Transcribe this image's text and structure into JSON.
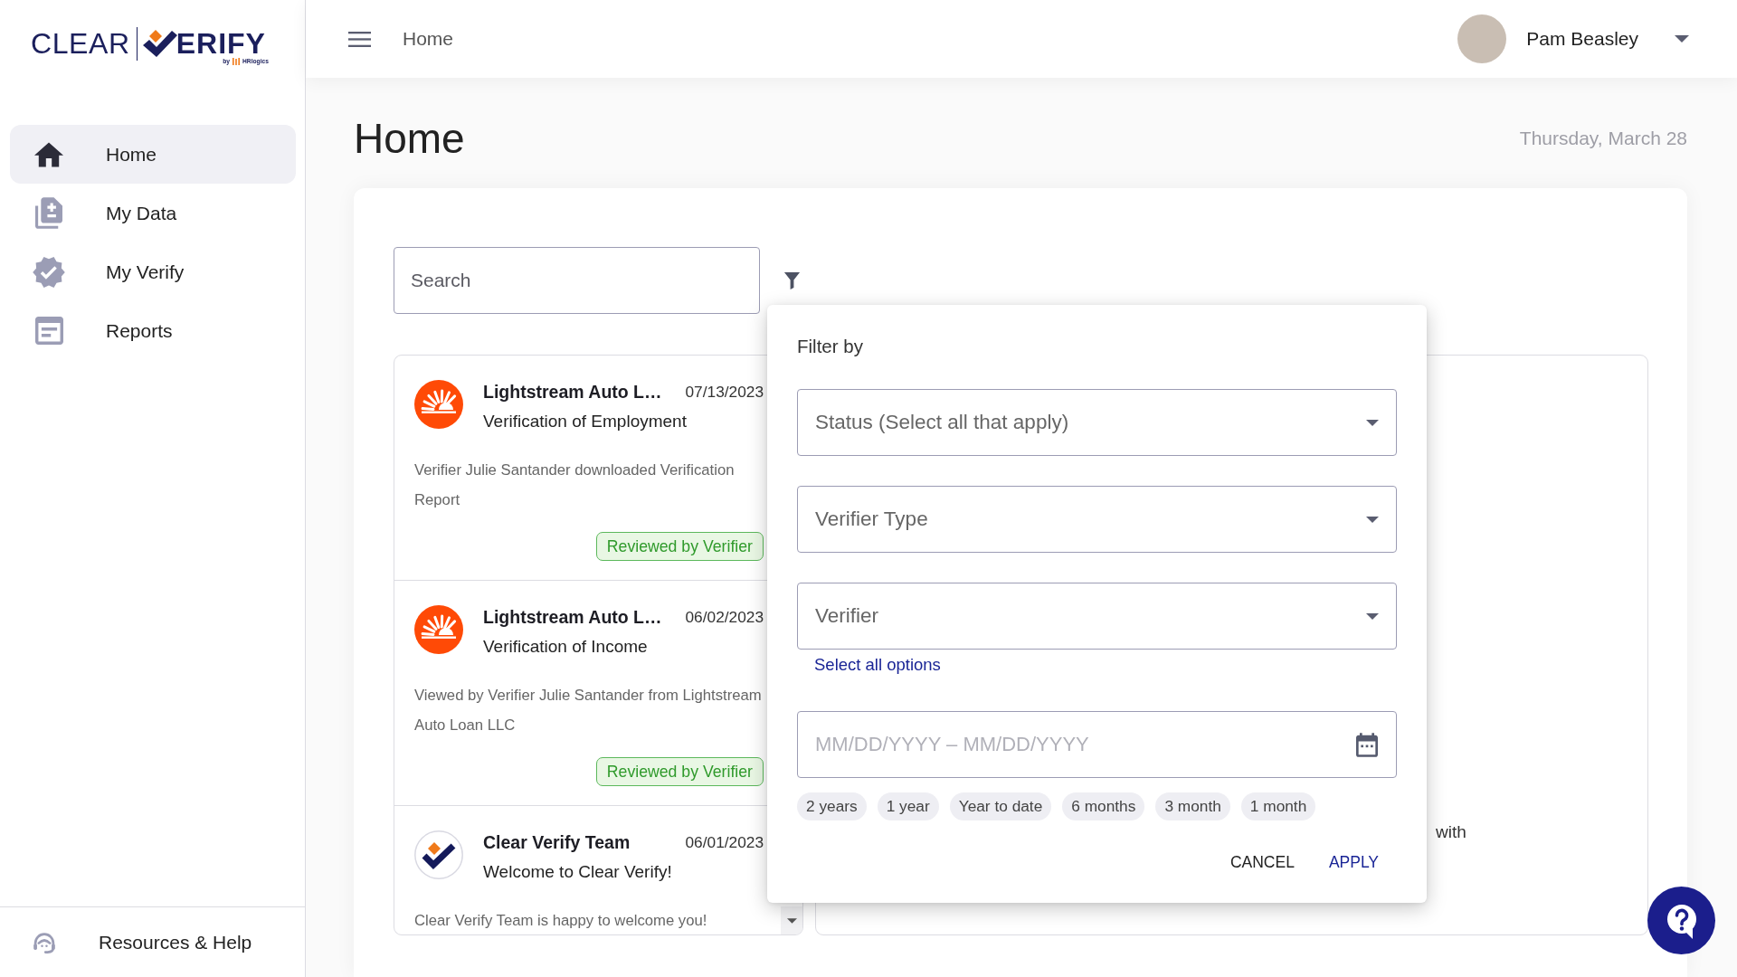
{
  "logo": {
    "word_1": "CLEAR",
    "word_2": "ERIFY",
    "byline_prefix": "by",
    "byline_brand": "HRlogics"
  },
  "sidebar": {
    "items": [
      {
        "kind": "home",
        "label": "Home",
        "selected": true
      },
      {
        "kind": "data",
        "label": "My Data",
        "selected": false
      },
      {
        "kind": "verify",
        "label": "My Verify",
        "selected": false
      },
      {
        "kind": "reports",
        "label": "Reports",
        "selected": false
      }
    ],
    "footer_item": {
      "kind": "help",
      "label": "Resources & Help"
    }
  },
  "top_bar": {
    "breadcrumb": "Home",
    "user": {
      "name": "Pam Beasley"
    }
  },
  "page": {
    "title": "Home",
    "date": "Thursday, March 28"
  },
  "search": {
    "placeholder": "Search"
  },
  "feed": [
    {
      "kind": "lightstream",
      "title": "Lightstream Auto L…",
      "date": "07/13/2023",
      "subtitle": "Verification of Employment",
      "description": "Verifier Julie Santander downloaded Verification Report",
      "badge": "Reviewed by Verifier"
    },
    {
      "kind": "lightstream",
      "title": "Lightstream Auto L…",
      "date": "06/02/2023",
      "subtitle": "Verification of Income",
      "description": "Viewed by Verifier Julie Santander from Lightstream Auto Loan LLC",
      "badge": "Reviewed by Verifier"
    },
    {
      "kind": "clear_verify",
      "title": "Clear Verify Team",
      "date": "06/01/2023",
      "subtitle": "Welcome to Clear Verify!",
      "description": "Clear Verify Team is happy to welcome you!"
    }
  ],
  "detail_panel": {
    "text": "with"
  },
  "filter_popup": {
    "title": "Filter by",
    "selects": [
      {
        "placeholder": "Status (Select all that apply)"
      },
      {
        "placeholder": "Verifier Type"
      },
      {
        "placeholder": "Verifier"
      }
    ],
    "select_all_link": "Select all options",
    "date_range": {
      "placeholder": "MM/DD/YYYY – MM/DD/YYYY"
    },
    "presets": [
      {
        "label": "2 years",
        "selected": false
      },
      {
        "label": "1 year",
        "selected": false
      },
      {
        "label": "Year to date",
        "selected": false
      },
      {
        "label": "6 months",
        "selected": false
      },
      {
        "label": "3 month",
        "selected": false
      },
      {
        "label": "1 month",
        "selected": false
      }
    ],
    "buttons": [
      {
        "kind": "secondary",
        "label": "CANCEL"
      },
      {
        "kind": "primary",
        "label": "APPLY"
      }
    ]
  }
}
